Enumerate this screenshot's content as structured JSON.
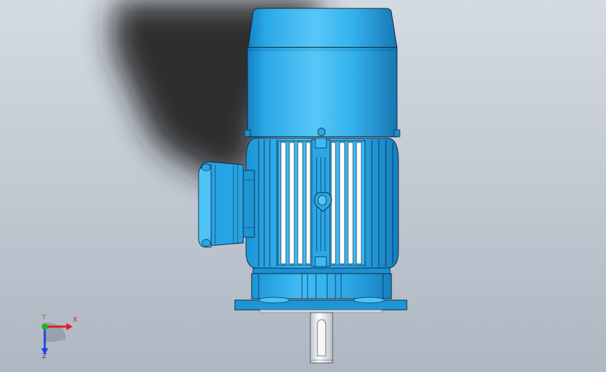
{
  "viewport": {
    "view_mode": "shaded-with-edges",
    "colors": {
      "background_top": "#d4dae2",
      "background_bottom": "#aeb7c2",
      "model_body": "#2aa7e6",
      "model_edge": "#0d2a40",
      "shadow": "#1e1e1e",
      "shaft": "#f0f0f0"
    }
  },
  "triad": {
    "x_label": "X",
    "y_label": "Y",
    "z_label": "Z",
    "colors": {
      "x": "#e02020",
      "y": "#20b020",
      "z": "#2040e0"
    }
  }
}
